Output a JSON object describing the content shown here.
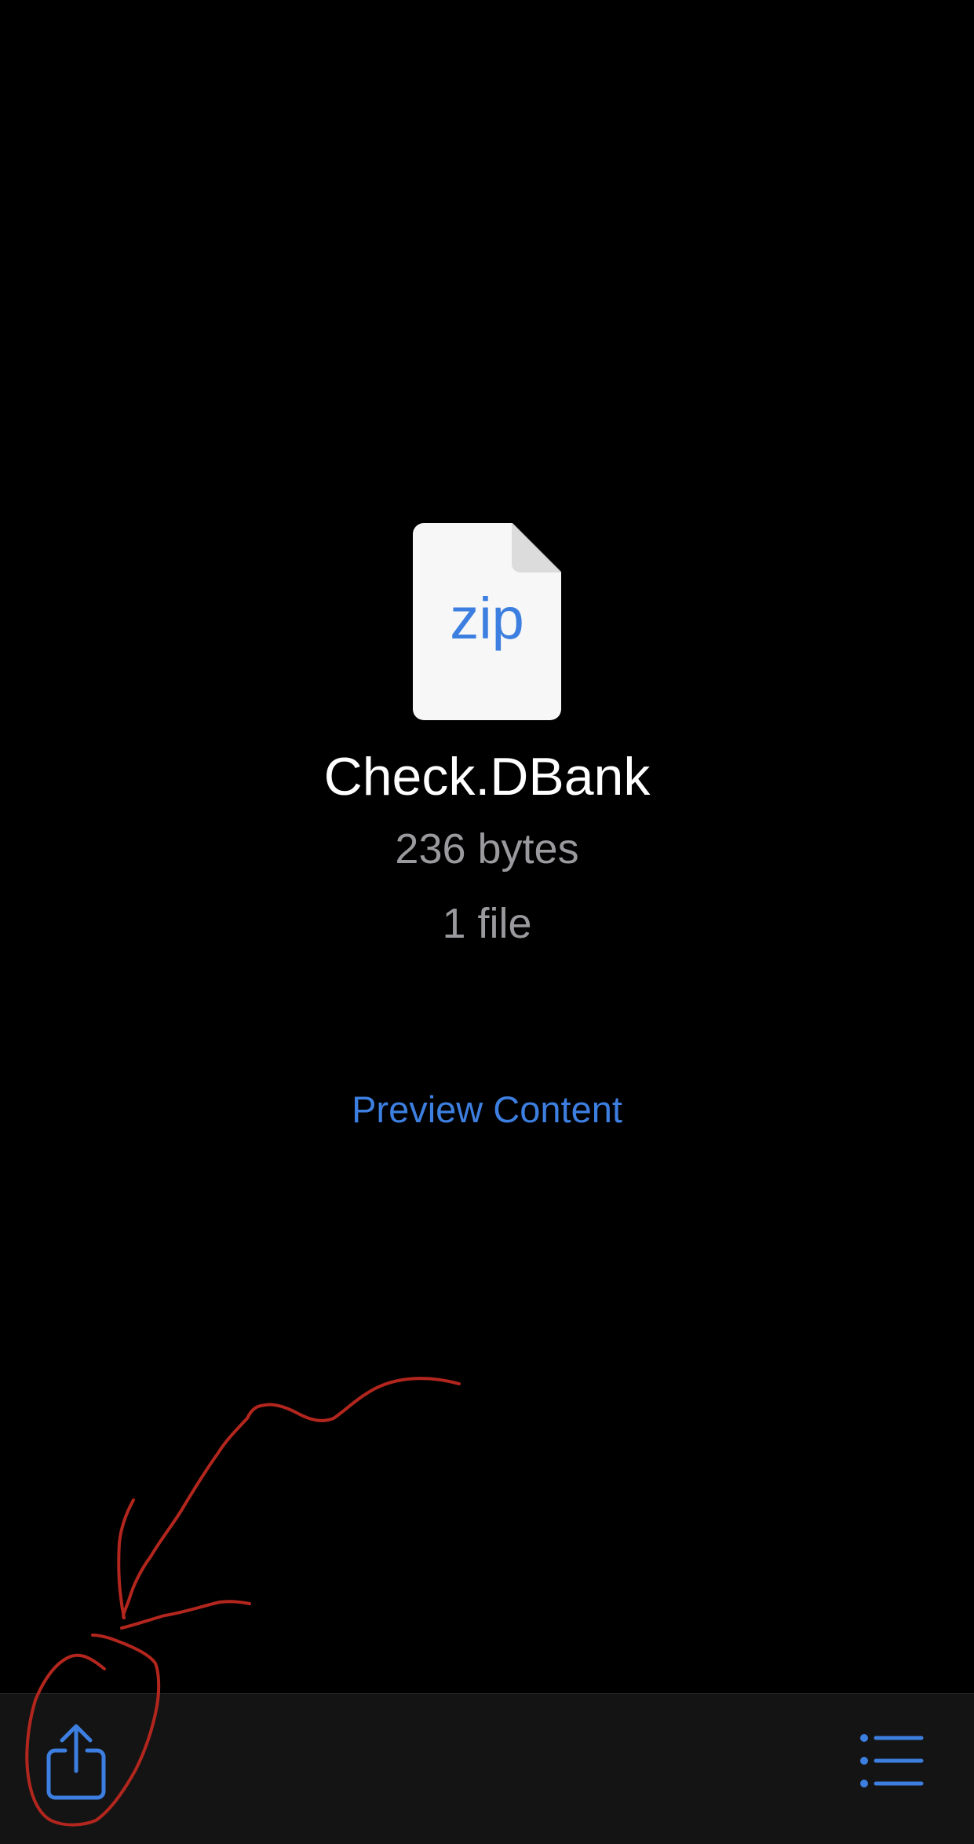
{
  "file": {
    "type_label": "zip",
    "name": "Check.DBank",
    "size": "236 bytes",
    "count": "1 file"
  },
  "actions": {
    "preview_label": "Preview Content"
  },
  "toolbar": {
    "share_icon": "share-icon",
    "list_icon": "list-icon"
  },
  "colors": {
    "accent": "#3d7fe0",
    "background": "#000000",
    "toolbar": "#141414",
    "secondary_text": "#9a9a9e",
    "annotation": "#b3261e"
  }
}
